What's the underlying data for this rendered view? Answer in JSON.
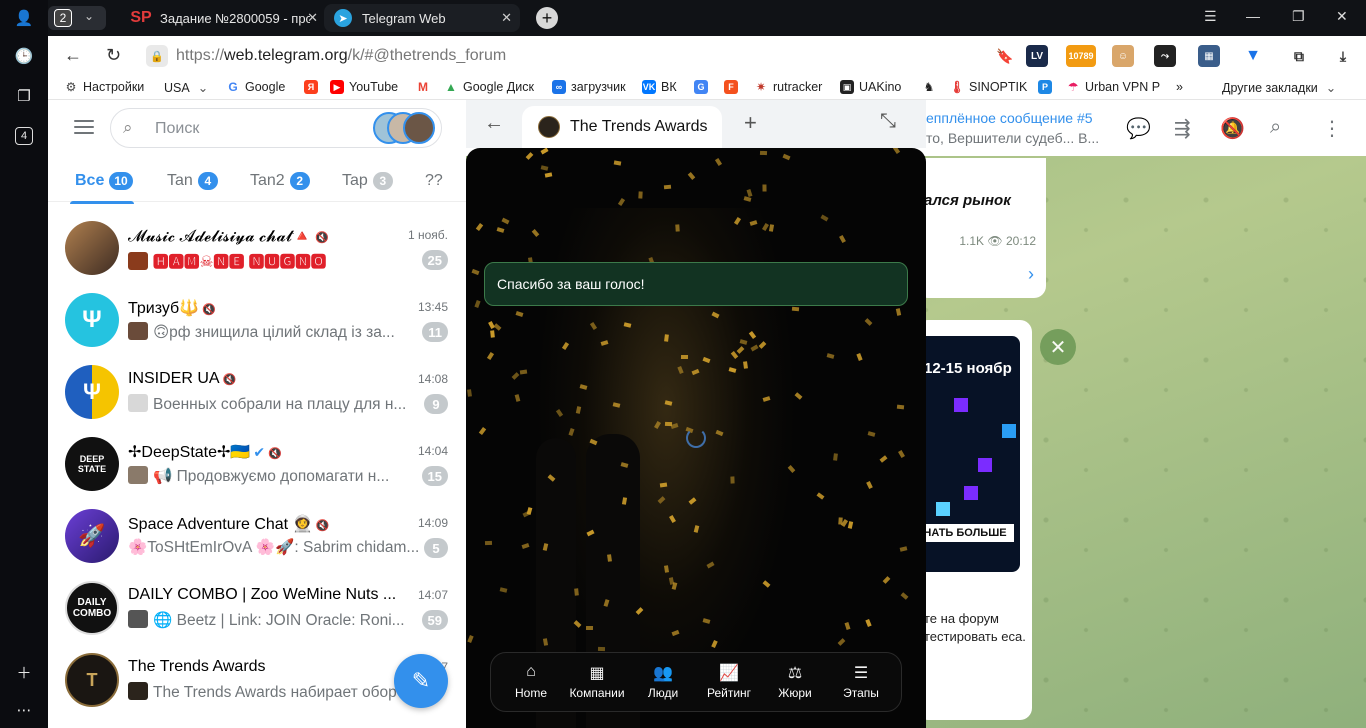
{
  "browser": {
    "tab_count": "2",
    "tabs": [
      {
        "title": "Задание №2800059 - прос",
        "icon": "sp-favicon"
      },
      {
        "title": "Telegram Web",
        "icon": "telegram-favicon"
      }
    ],
    "rail_badge": "4",
    "url_proto": "https://",
    "url_host": "web.telegram.org",
    "url_rest": "/k/#@thetrends_forum",
    "address_overlay": "репплённое сообщение #5",
    "bookmarks": [
      "Настройки",
      "USA",
      "Google",
      "YouTube",
      "Google Диск",
      "загрузчик",
      "ВК",
      "rutracker",
      "UAKino",
      "SINOPTIK",
      "Urban VPN P"
    ],
    "bookmarks_more": "»",
    "other_bookmarks": "Другие закладки",
    "ext_badge": "10789"
  },
  "telegram": {
    "search_placeholder": "Поиск",
    "folders": [
      {
        "label": "Все",
        "count": "10"
      },
      {
        "label": "Tan",
        "count": "4"
      },
      {
        "label": "Tan2",
        "count": "2"
      },
      {
        "label": "Tap",
        "count": "3"
      },
      {
        "label": "??",
        "count": ""
      }
    ],
    "chats": [
      {
        "name": "𝓜𝓾𝓼𝓲𝓬 𝓐𝓭𝓮𝓵𝓲𝓼𝓲𝔂𝓪 𝓬𝓱𝓪𝓽🔺",
        "time": "1 нояб.",
        "msg": "🅷🅰🅼☠🅽🅴 🅽🆄🅶🅽🅾",
        "unread": "25"
      },
      {
        "name": "Тризуб🔱",
        "time": "13:45",
        "msg": "🙃рф знищила цілий склад із за...",
        "unread": "11"
      },
      {
        "name": "INSIDER UA",
        "time": "14:08",
        "msg": "Военных собрали на плацу для н...",
        "unread": "9"
      },
      {
        "name": "✢DeepState✢🇺🇦",
        "time": "14:04",
        "msg": "📢 Продовжуємо допомагати н...",
        "unread": "15"
      },
      {
        "name": "Space Adventure Chat 👩‍🚀",
        "time": "14:09",
        "msg": "🌸ToSHtEmIrOvA 🌸🚀: Sabrim chidam...",
        "unread": "5"
      },
      {
        "name": "DAILY COMBO | Zoo WeMine Nuts ...",
        "time": "14:07",
        "msg": "🌐 Beetz | Link: JOIN Oracle: Roni...",
        "unread": "59"
      },
      {
        "name": "The Trends Awards",
        "time": "7",
        "msg": "The Trends Awards набирает обор",
        "unread": ""
      }
    ],
    "chat_header": {
      "pinned_title": "епплённое сообщение #5",
      "pinned_text": "то, Вершители судеб... В..."
    },
    "message": {
      "text": "ался рынок",
      "views": "1.1K",
      "time": "20:12"
    },
    "ad": {
      "dates": "12-15 ноябр",
      "cta": "НАТЬ БОЛЬШЕ",
      "text": "те на форум тестировать еса."
    }
  },
  "miniapp": {
    "title": "The Trends Awards",
    "toast": "Спасибо за ваш голос!",
    "nav": [
      {
        "label": "Home",
        "icon": "home-icon"
      },
      {
        "label": "Компании",
        "icon": "building-icon"
      },
      {
        "label": "Люди",
        "icon": "people-icon"
      },
      {
        "label": "Рейтинг",
        "icon": "chart-icon"
      },
      {
        "label": "Жюри",
        "icon": "scales-icon"
      },
      {
        "label": "Этапы",
        "icon": "list-icon"
      }
    ]
  }
}
